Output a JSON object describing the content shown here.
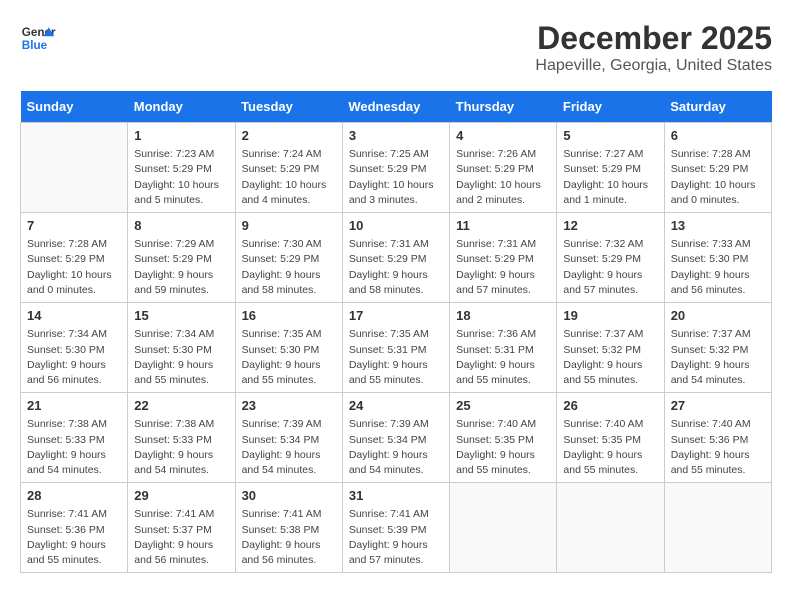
{
  "logo": {
    "line1": "General",
    "line2": "Blue"
  },
  "title": "December 2025",
  "subtitle": "Hapeville, Georgia, United States",
  "days_of_week": [
    "Sunday",
    "Monday",
    "Tuesday",
    "Wednesday",
    "Thursday",
    "Friday",
    "Saturday"
  ],
  "weeks": [
    [
      {
        "day": "",
        "info": ""
      },
      {
        "day": "1",
        "info": "Sunrise: 7:23 AM\nSunset: 5:29 PM\nDaylight: 10 hours\nand 5 minutes."
      },
      {
        "day": "2",
        "info": "Sunrise: 7:24 AM\nSunset: 5:29 PM\nDaylight: 10 hours\nand 4 minutes."
      },
      {
        "day": "3",
        "info": "Sunrise: 7:25 AM\nSunset: 5:29 PM\nDaylight: 10 hours\nand 3 minutes."
      },
      {
        "day": "4",
        "info": "Sunrise: 7:26 AM\nSunset: 5:29 PM\nDaylight: 10 hours\nand 2 minutes."
      },
      {
        "day": "5",
        "info": "Sunrise: 7:27 AM\nSunset: 5:29 PM\nDaylight: 10 hours\nand 1 minute."
      },
      {
        "day": "6",
        "info": "Sunrise: 7:28 AM\nSunset: 5:29 PM\nDaylight: 10 hours\nand 0 minutes."
      }
    ],
    [
      {
        "day": "7",
        "info": "Sunrise: 7:28 AM\nSunset: 5:29 PM\nDaylight: 10 hours\nand 0 minutes."
      },
      {
        "day": "8",
        "info": "Sunrise: 7:29 AM\nSunset: 5:29 PM\nDaylight: 9 hours\nand 59 minutes."
      },
      {
        "day": "9",
        "info": "Sunrise: 7:30 AM\nSunset: 5:29 PM\nDaylight: 9 hours\nand 58 minutes."
      },
      {
        "day": "10",
        "info": "Sunrise: 7:31 AM\nSunset: 5:29 PM\nDaylight: 9 hours\nand 58 minutes."
      },
      {
        "day": "11",
        "info": "Sunrise: 7:31 AM\nSunset: 5:29 PM\nDaylight: 9 hours\nand 57 minutes."
      },
      {
        "day": "12",
        "info": "Sunrise: 7:32 AM\nSunset: 5:29 PM\nDaylight: 9 hours\nand 57 minutes."
      },
      {
        "day": "13",
        "info": "Sunrise: 7:33 AM\nSunset: 5:30 PM\nDaylight: 9 hours\nand 56 minutes."
      }
    ],
    [
      {
        "day": "14",
        "info": "Sunrise: 7:34 AM\nSunset: 5:30 PM\nDaylight: 9 hours\nand 56 minutes."
      },
      {
        "day": "15",
        "info": "Sunrise: 7:34 AM\nSunset: 5:30 PM\nDaylight: 9 hours\nand 55 minutes."
      },
      {
        "day": "16",
        "info": "Sunrise: 7:35 AM\nSunset: 5:30 PM\nDaylight: 9 hours\nand 55 minutes."
      },
      {
        "day": "17",
        "info": "Sunrise: 7:35 AM\nSunset: 5:31 PM\nDaylight: 9 hours\nand 55 minutes."
      },
      {
        "day": "18",
        "info": "Sunrise: 7:36 AM\nSunset: 5:31 PM\nDaylight: 9 hours\nand 55 minutes."
      },
      {
        "day": "19",
        "info": "Sunrise: 7:37 AM\nSunset: 5:32 PM\nDaylight: 9 hours\nand 55 minutes."
      },
      {
        "day": "20",
        "info": "Sunrise: 7:37 AM\nSunset: 5:32 PM\nDaylight: 9 hours\nand 54 minutes."
      }
    ],
    [
      {
        "day": "21",
        "info": "Sunrise: 7:38 AM\nSunset: 5:33 PM\nDaylight: 9 hours\nand 54 minutes."
      },
      {
        "day": "22",
        "info": "Sunrise: 7:38 AM\nSunset: 5:33 PM\nDaylight: 9 hours\nand 54 minutes."
      },
      {
        "day": "23",
        "info": "Sunrise: 7:39 AM\nSunset: 5:34 PM\nDaylight: 9 hours\nand 54 minutes."
      },
      {
        "day": "24",
        "info": "Sunrise: 7:39 AM\nSunset: 5:34 PM\nDaylight: 9 hours\nand 54 minutes."
      },
      {
        "day": "25",
        "info": "Sunrise: 7:40 AM\nSunset: 5:35 PM\nDaylight: 9 hours\nand 55 minutes."
      },
      {
        "day": "26",
        "info": "Sunrise: 7:40 AM\nSunset: 5:35 PM\nDaylight: 9 hours\nand 55 minutes."
      },
      {
        "day": "27",
        "info": "Sunrise: 7:40 AM\nSunset: 5:36 PM\nDaylight: 9 hours\nand 55 minutes."
      }
    ],
    [
      {
        "day": "28",
        "info": "Sunrise: 7:41 AM\nSunset: 5:36 PM\nDaylight: 9 hours\nand 55 minutes."
      },
      {
        "day": "29",
        "info": "Sunrise: 7:41 AM\nSunset: 5:37 PM\nDaylight: 9 hours\nand 56 minutes."
      },
      {
        "day": "30",
        "info": "Sunrise: 7:41 AM\nSunset: 5:38 PM\nDaylight: 9 hours\nand 56 minutes."
      },
      {
        "day": "31",
        "info": "Sunrise: 7:41 AM\nSunset: 5:39 PM\nDaylight: 9 hours\nand 57 minutes."
      },
      {
        "day": "",
        "info": ""
      },
      {
        "day": "",
        "info": ""
      },
      {
        "day": "",
        "info": ""
      }
    ]
  ]
}
